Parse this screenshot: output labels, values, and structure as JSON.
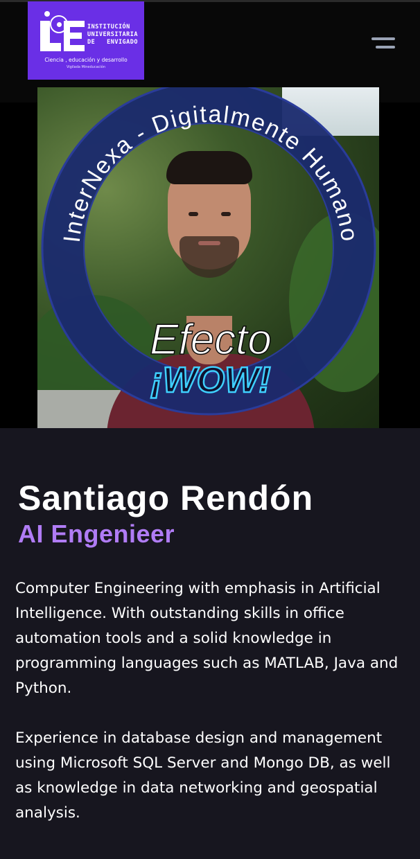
{
  "header": {
    "logo": {
      "name_lines": [
        "INSTITUCIÓN",
        "UNIVERSITARIA",
        "DE   ENVIGADO"
      ],
      "tagline": "Ciencia , educación y desarrollo",
      "sub": "Vigilada Mineducación"
    },
    "menu_icon": "hamburger-menu-icon"
  },
  "photo": {
    "ring_text": "InterNexa - Digitalmente Humano",
    "badge_line1": "Efecto",
    "badge_line2": "¡WOW!"
  },
  "profile": {
    "name": "Santiago Rendón",
    "role": "AI Engenieer",
    "paragraphs": [
      "Computer Engineering with emphasis in Artificial Intelligence. With outstanding skills in office automation tools and a solid knowledge in programming languages such as MATLAB, Java and Python.",
      "Experience in database design and management using Microsoft SQL Server and Mongo DB, as well as knowledge in data networking and geospatial analysis."
    ]
  },
  "colors": {
    "page_bg": "#17161f",
    "logo_bg": "#6a2fe6",
    "role": "#b07cf5",
    "ring": "#1a2a6e"
  }
}
